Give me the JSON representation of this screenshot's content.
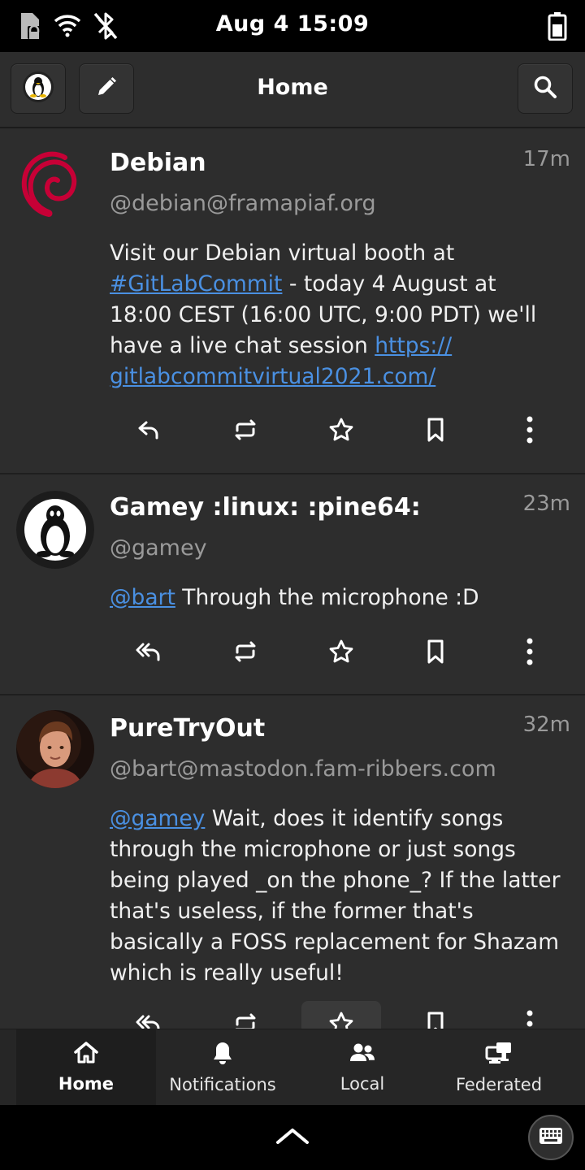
{
  "statusbar": {
    "time": "Aug 4  15:09",
    "icons": [
      "sim-icon",
      "wifi-icon",
      "bluetooth-off-icon",
      "battery-icon"
    ]
  },
  "header": {
    "title": "Home",
    "left_buttons": [
      "account-avatar-icon",
      "compose-pencil-icon"
    ],
    "right_buttons": [
      "search-icon"
    ]
  },
  "posts": [
    {
      "name": "Debian",
      "handle": "@debian@framapiaf.org",
      "time": "17m",
      "avatar": "debian-swirl-logo",
      "body": {
        "t1": "Visit our Debian virtual booth at",
        "hashtag": "#GitLabCommit",
        "t2": " - today 4 August at 18:00 CEST (16:00 UTC, 9:00 PDT) we'll have a live chat session ",
        "link1": "https://",
        "link2": "gitlabcommitvirtual2021.com/"
      }
    },
    {
      "name": "Gamey :linux: :pine64:",
      "handle": "@gamey",
      "time": "23m",
      "avatar": "tux-penguin-avatar",
      "body": {
        "mention": "@bart",
        "text": " Through the microphone :D"
      }
    },
    {
      "name": "PureTryOut",
      "handle": "@bart@mastodon.fam-ribbers.com",
      "time": "32m",
      "avatar": "person-photo-avatar",
      "body": {
        "mention": "@gamey",
        "text": " Wait, does it identify songs through the microphone or just songs being played _on the phone_? If the latter that's useless, if the former that's basically a FOSS replacement for Shazam which is really useful!"
      }
    }
  ],
  "post_actions": [
    "reply-icon",
    "boost-icon",
    "favourite-star-icon",
    "bookmark-icon",
    "more-vertical-icon"
  ],
  "bottom_nav": [
    {
      "label": "Home",
      "icon": "home-icon",
      "active": true
    },
    {
      "label": "Notifications",
      "icon": "bell-icon",
      "active": false
    },
    {
      "label": "Local",
      "icon": "people-icon",
      "active": false
    },
    {
      "label": "Federated",
      "icon": "federated-network-icon",
      "active": false
    }
  ],
  "colors": {
    "background": "#2d2d2d",
    "link": "#4a90e2",
    "secondary_text": "#9a9a9a",
    "debian_red": "#c70036"
  }
}
